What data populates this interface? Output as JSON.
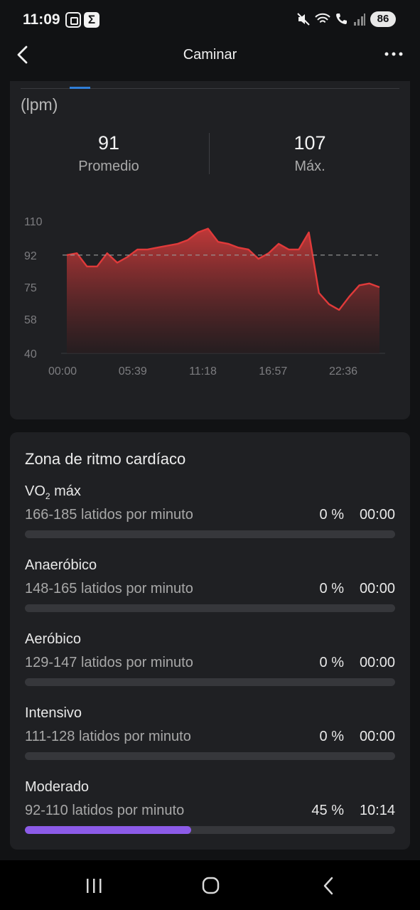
{
  "status": {
    "time": "11:09",
    "battery": "86"
  },
  "header": {
    "title": "Caminar"
  },
  "summary": {
    "unit": "(lpm)",
    "average_value": "91",
    "average_label": "Promedio",
    "max_value": "107",
    "max_label": "Máx."
  },
  "chart_data": {
    "type": "area",
    "series_color": "#e03a3a",
    "average_line": 92,
    "yticks": [
      "110",
      "92",
      "75",
      "58",
      "40"
    ],
    "ylim": [
      40,
      110
    ],
    "xticks": [
      "00:00",
      "05:39",
      "11:18",
      "16:57",
      "22:36"
    ],
    "x": [
      "00:00",
      "00:50",
      "01:40",
      "02:30",
      "03:20",
      "04:10",
      "05:00",
      "05:39",
      "06:30",
      "07:20",
      "08:10",
      "09:00",
      "09:50",
      "10:40",
      "11:18",
      "12:10",
      "13:00",
      "13:50",
      "14:40",
      "15:30",
      "16:20",
      "16:57",
      "17:50",
      "18:40",
      "19:30",
      "19:45",
      "20:00",
      "20:30",
      "21:00",
      "21:40",
      "22:10",
      "22:36"
    ],
    "values": [
      92,
      93,
      86,
      86,
      93,
      88,
      91,
      95,
      95,
      96,
      97,
      98,
      100,
      104,
      106,
      99,
      98,
      96,
      95,
      90,
      93,
      98,
      95,
      95,
      104,
      72,
      66,
      63,
      70,
      76,
      77,
      75
    ]
  },
  "zones": {
    "title": "Zona de ritmo cardíaco",
    "items": [
      {
        "name": "VO",
        "name_sub": "2",
        "name_suffix": " máx",
        "range": "166-185 latidos por minuto",
        "pct": "0 %",
        "time": "00:00",
        "fraction": 0
      },
      {
        "name": "Anaeróbico",
        "range": "148-165 latidos por minuto",
        "pct": "0 %",
        "time": "00:00",
        "fraction": 0
      },
      {
        "name": "Aeróbico",
        "range": "129-147 latidos por minuto",
        "pct": "0 %",
        "time": "00:00",
        "fraction": 0
      },
      {
        "name": "Intensivo",
        "range": "111-128 latidos por minuto",
        "pct": "0 %",
        "time": "00:00",
        "fraction": 0
      },
      {
        "name": "Moderado",
        "range": "92-110 latidos por minuto",
        "pct": "45 %",
        "time": "10:14",
        "fraction": 0.45
      }
    ]
  }
}
